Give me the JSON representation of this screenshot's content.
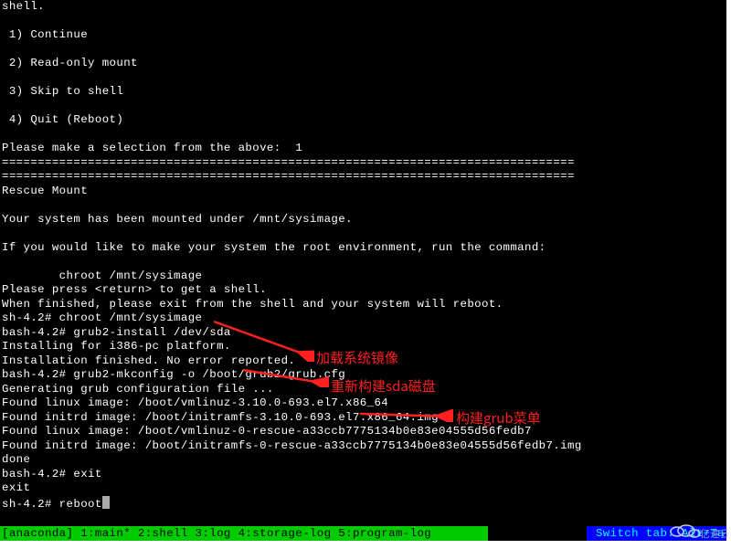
{
  "terminal": {
    "lines": [
      "shell.",
      "",
      " 1) Continue",
      "",
      " 2) Read-only mount",
      "",
      " 3) Skip to shell",
      "",
      " 4) Quit (Reboot)",
      "",
      "Please make a selection from the above:  1",
      "================================================================================",
      "================================================================================",
      "Rescue Mount",
      "",
      "Your system has been mounted under /mnt/sysimage.",
      "",
      "If you would like to make your system the root environment, run the command:",
      "",
      "        chroot /mnt/sysimage",
      "Please press <return> to get a shell.",
      "When finished, please exit from the shell and your system will reboot.",
      "sh-4.2# chroot /mnt/sysimage",
      "bash-4.2# grub2-install /dev/sda",
      "Installing for i386-pc platform.",
      "Installation finished. No error reported.",
      "bash-4.2# grub2-mkconfig -o /boot/grub2/grub.cfg",
      "Generating grub configuration file ...",
      "Found linux image: /boot/vmlinuz-3.10.0-693.el7.x86_64",
      "Found initrd image: /boot/initramfs-3.10.0-693.el7.x86_64.img",
      "Found linux image: /boot/vmlinuz-0-rescue-a33ccb7775134b0e83e04555d56fedb7",
      "Found initrd image: /boot/initramfs-0-rescue-a33ccb7775134b0e83e04555d56fedb7.img",
      "done",
      "bash-4.2# exit",
      "exit",
      "sh-4.2# reboot"
    ],
    "cursor_after_last": true
  },
  "annotations": {
    "a1": "加载系统镜像",
    "a2": "重新构建sda磁盘",
    "a3": "构建grub菜单"
  },
  "statusbar": {
    "left": "[anaconda] 1:main* 2:shell  3:log  4:storage-log  5:program-log",
    "right": "Switch tab: Alt+Ta"
  },
  "watermark": "亿速云"
}
